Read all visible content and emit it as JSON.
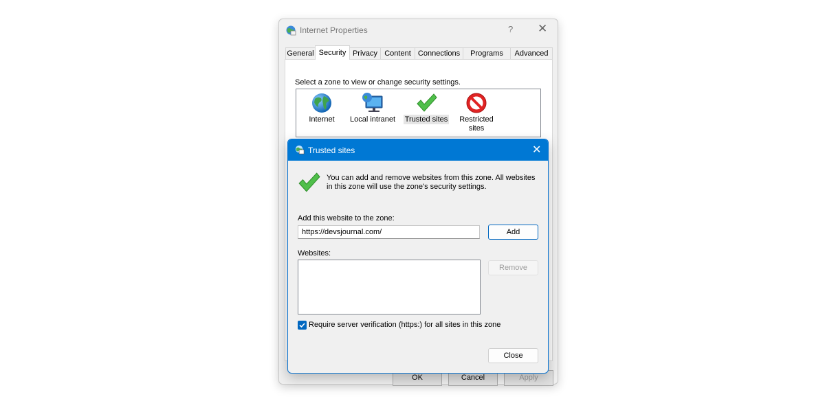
{
  "back_window": {
    "title": "Internet Properties",
    "help_glyph": "?",
    "close_glyph": "✕",
    "tabs": [
      {
        "label": "General",
        "active": false
      },
      {
        "label": "Security",
        "active": true
      },
      {
        "label": "Privacy",
        "active": false
      },
      {
        "label": "Content",
        "active": false
      },
      {
        "label": "Connections",
        "active": false
      },
      {
        "label": "Programs",
        "active": false
      },
      {
        "label": "Advanced",
        "active": false
      }
    ],
    "zone_prompt": "Select a zone to view or change security settings.",
    "zones": [
      {
        "label": "Internet",
        "icon": "globe-icon"
      },
      {
        "label": "Local intranet",
        "icon": "intranet-icon"
      },
      {
        "label": "Trusted sites",
        "icon": "checkmark-icon",
        "selected": true
      },
      {
        "label": "Restricted sites",
        "icon": "restricted-icon"
      }
    ],
    "buttons": {
      "ok": "OK",
      "cancel": "Cancel",
      "apply": "Apply"
    }
  },
  "dialog": {
    "title": "Trusted sites",
    "close_glyph": "✕",
    "info_text": "You can add and remove websites from this zone. All websites in this zone will use the zone's security settings.",
    "add_label": "Add this website to the zone:",
    "url_value": "https://devsjournal.com/",
    "add_button": "Add",
    "websites_label": "Websites:",
    "websites": [],
    "remove_button": "Remove",
    "require_https_label": "Require server verification (https:) for all sites in this zone",
    "require_https_checked": true,
    "close_button": "Close"
  },
  "colors": {
    "dialog_titlebar": "#0078d4",
    "accent": "#0067c0",
    "window_bg": "#f0f0f0"
  }
}
